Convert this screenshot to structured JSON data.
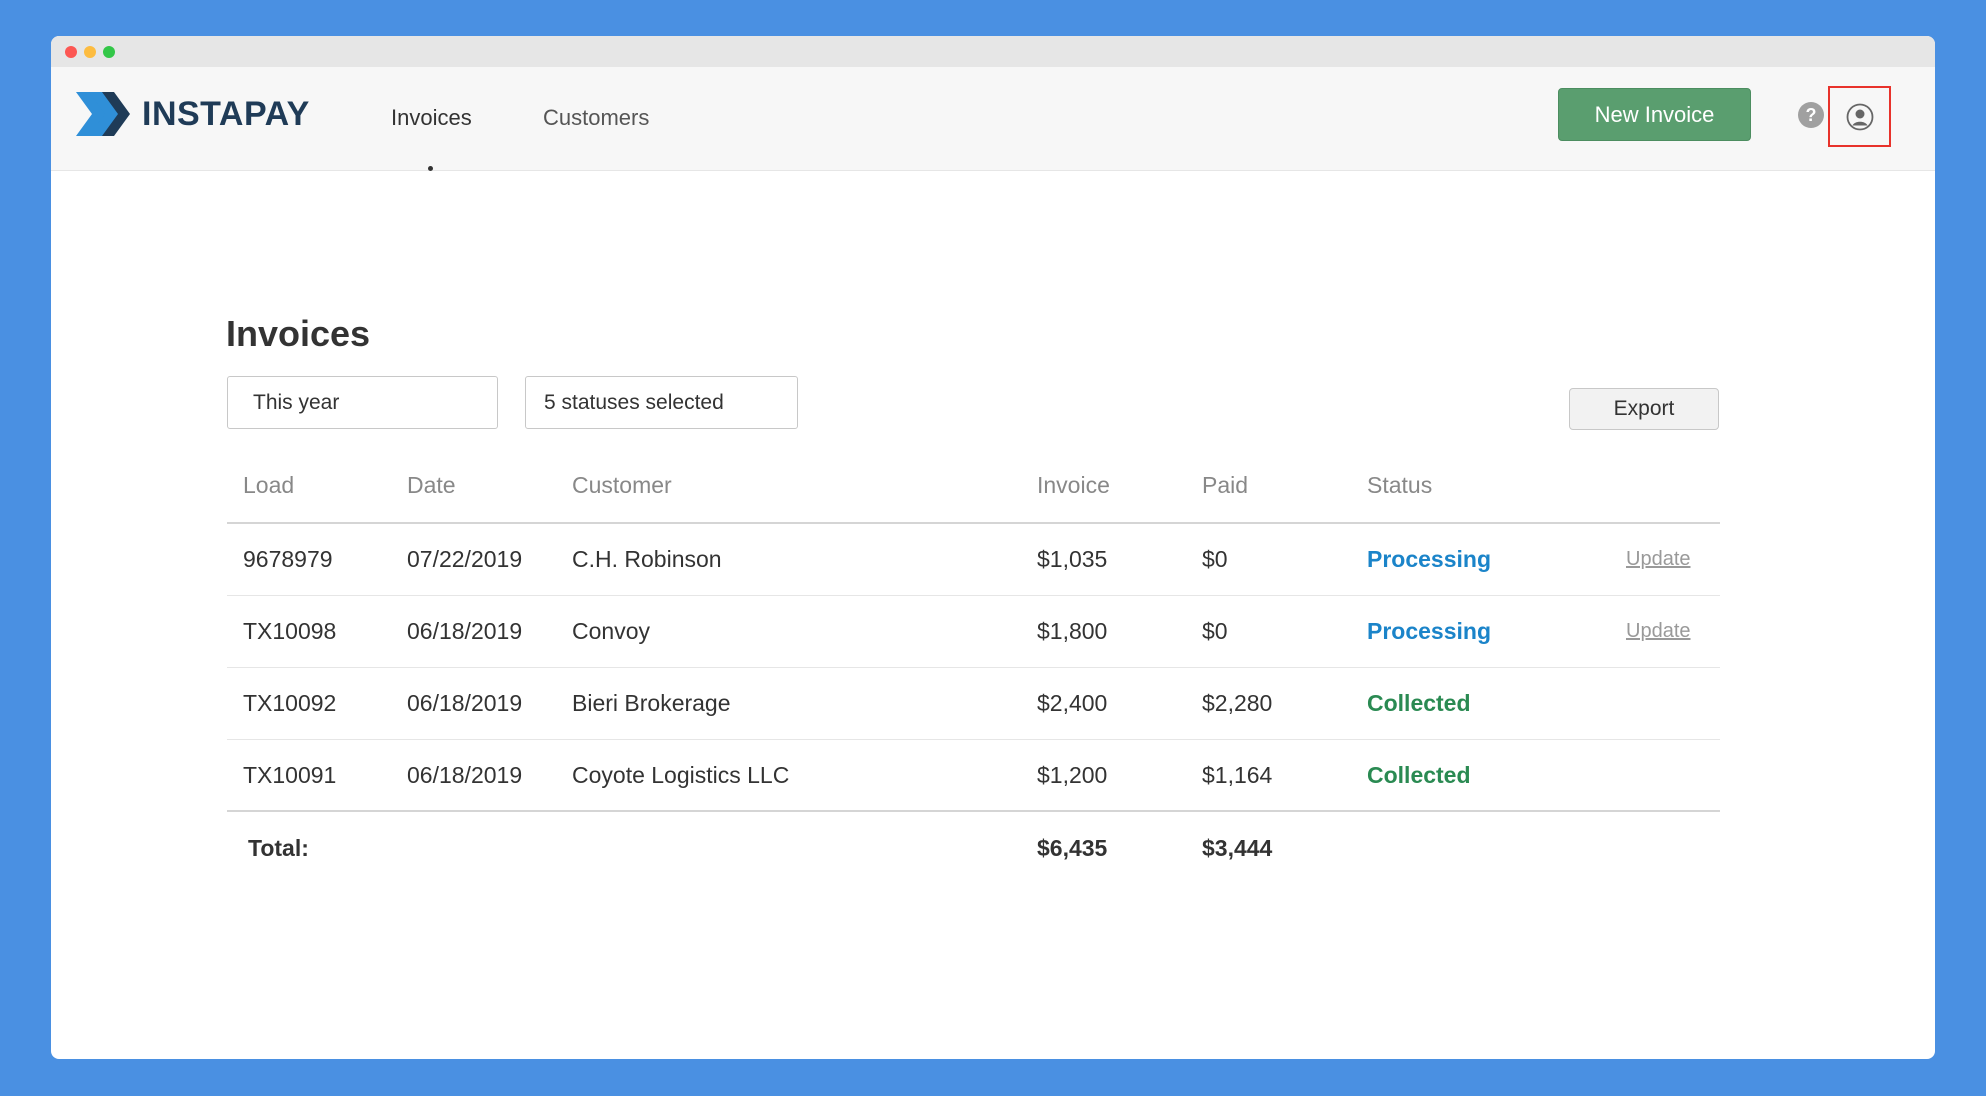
{
  "app": {
    "brand": "INSTAPAY",
    "nav": [
      {
        "label": "Invoices",
        "active": true
      },
      {
        "label": "Customers",
        "active": false
      }
    ],
    "new_invoice_label": "New Invoice",
    "help_glyph": "?",
    "icons": {
      "help": "help-icon",
      "account": "user-account-icon",
      "logo": "chevron-logo-icon"
    }
  },
  "page": {
    "title": "Invoices",
    "filters": {
      "date_range": "This year",
      "statuses": "5 statuses selected"
    },
    "export_label": "Export"
  },
  "table": {
    "columns": [
      "Load",
      "Date",
      "Customer",
      "Invoice",
      "Paid",
      "Status"
    ],
    "rows": [
      {
        "load": "9678979",
        "date": "07/22/2019",
        "customer": "C.H. Robinson",
        "invoice": "$1,035",
        "paid": "$0",
        "status": "Processing",
        "action": "Update"
      },
      {
        "load": "TX10098",
        "date": "06/18/2019",
        "customer": "Convoy",
        "invoice": "$1,800",
        "paid": "$0",
        "status": "Processing",
        "action": "Update"
      },
      {
        "load": "TX10092",
        "date": "06/18/2019",
        "customer": "Bieri Brokerage",
        "invoice": "$2,400",
        "paid": "$2,280",
        "status": "Collected",
        "action": ""
      },
      {
        "load": "TX10091",
        "date": "06/18/2019",
        "customer": "Coyote Logistics LLC",
        "invoice": "$1,200",
        "paid": "$1,164",
        "status": "Collected",
        "action": ""
      }
    ],
    "total": {
      "label": "Total:",
      "invoice": "$6,435",
      "paid": "$3,444"
    }
  },
  "colors": {
    "background": "#4a90e2",
    "primary_button": "#5a9e6f",
    "processing": "#1b84c9",
    "collected": "#2a8a52",
    "highlight": "#e8322b",
    "brand_dark": "#1f3b57",
    "brand_blue": "#2f8fd8"
  }
}
